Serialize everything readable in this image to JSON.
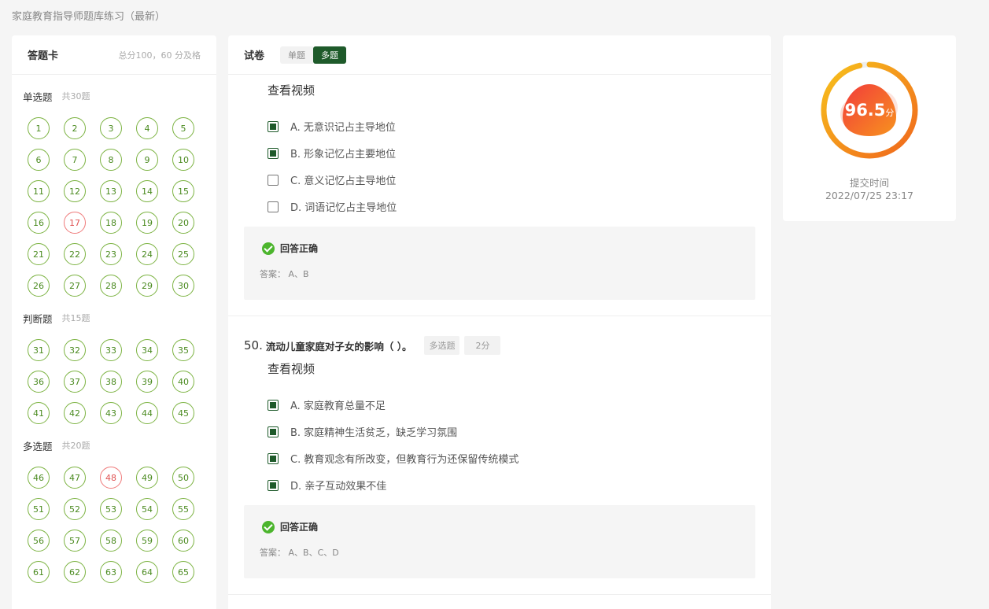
{
  "page_title": "家庭教育指导师题库练习（最新）",
  "answer_card": {
    "title": "答题卡",
    "summary": "总分100，60 分及格",
    "sections": [
      {
        "name": "单选题",
        "count": "共30题",
        "items": [
          "1",
          "2",
          "3",
          "4",
          "5",
          "6",
          "7",
          "8",
          "9",
          "10",
          "11",
          "12",
          "13",
          "14",
          "15",
          "16",
          "17",
          "18",
          "19",
          "20",
          "21",
          "22",
          "23",
          "24",
          "25",
          "26",
          "27",
          "28",
          "29",
          "30"
        ],
        "wrong": [
          "17"
        ]
      },
      {
        "name": "判断题",
        "count": "共15题",
        "items": [
          "31",
          "32",
          "33",
          "34",
          "35",
          "36",
          "37",
          "38",
          "39",
          "40",
          "41",
          "42",
          "43",
          "44",
          "45"
        ],
        "wrong": []
      },
      {
        "name": "多选题",
        "count": "共20题",
        "items": [
          "46",
          "47",
          "48",
          "49",
          "50",
          "51",
          "52",
          "53",
          "54",
          "55",
          "56",
          "57",
          "58",
          "59",
          "60",
          "61",
          "62",
          "63",
          "64",
          "65"
        ],
        "wrong": [
          "48"
        ]
      }
    ]
  },
  "exam": {
    "title": "试卷",
    "tabs": [
      "单题",
      "多题"
    ],
    "active_tab": "多题",
    "q49": {
      "video": "查看视频",
      "options": [
        "A. 无意识记占主导地位",
        "B. 形象记忆占主要地位",
        "C. 意义记忆占主导地位",
        "D. 词语记忆占主导地位"
      ],
      "checked": [
        true,
        true,
        false,
        false
      ],
      "status": "回答正确",
      "answer": "答案： A、B"
    },
    "q50": {
      "number": "50.",
      "text": "流动儿童家庭对子女的影响（ ）。",
      "type": "多选题",
      "points": "2分",
      "video": "查看视频",
      "options": [
        "A. 家庭教育总量不足",
        "B. 家庭精神生活贫乏，缺乏学习氛围",
        "C. 教育观念有所改变，但教育行为还保留传统模式",
        "D. 亲子互动效果不佳"
      ],
      "checked": [
        true,
        true,
        true,
        true
      ],
      "status": "回答正确",
      "answer": "答案： A、B、C、D"
    }
  },
  "score": {
    "value": "96.5",
    "unit": "分",
    "submit_label": "提交时间",
    "submit_time": "2022/07/25 23:17",
    "colors": {
      "ring_start": "#f5c518",
      "ring_end": "#f06a1a",
      "blob": "#f05a3a"
    }
  }
}
